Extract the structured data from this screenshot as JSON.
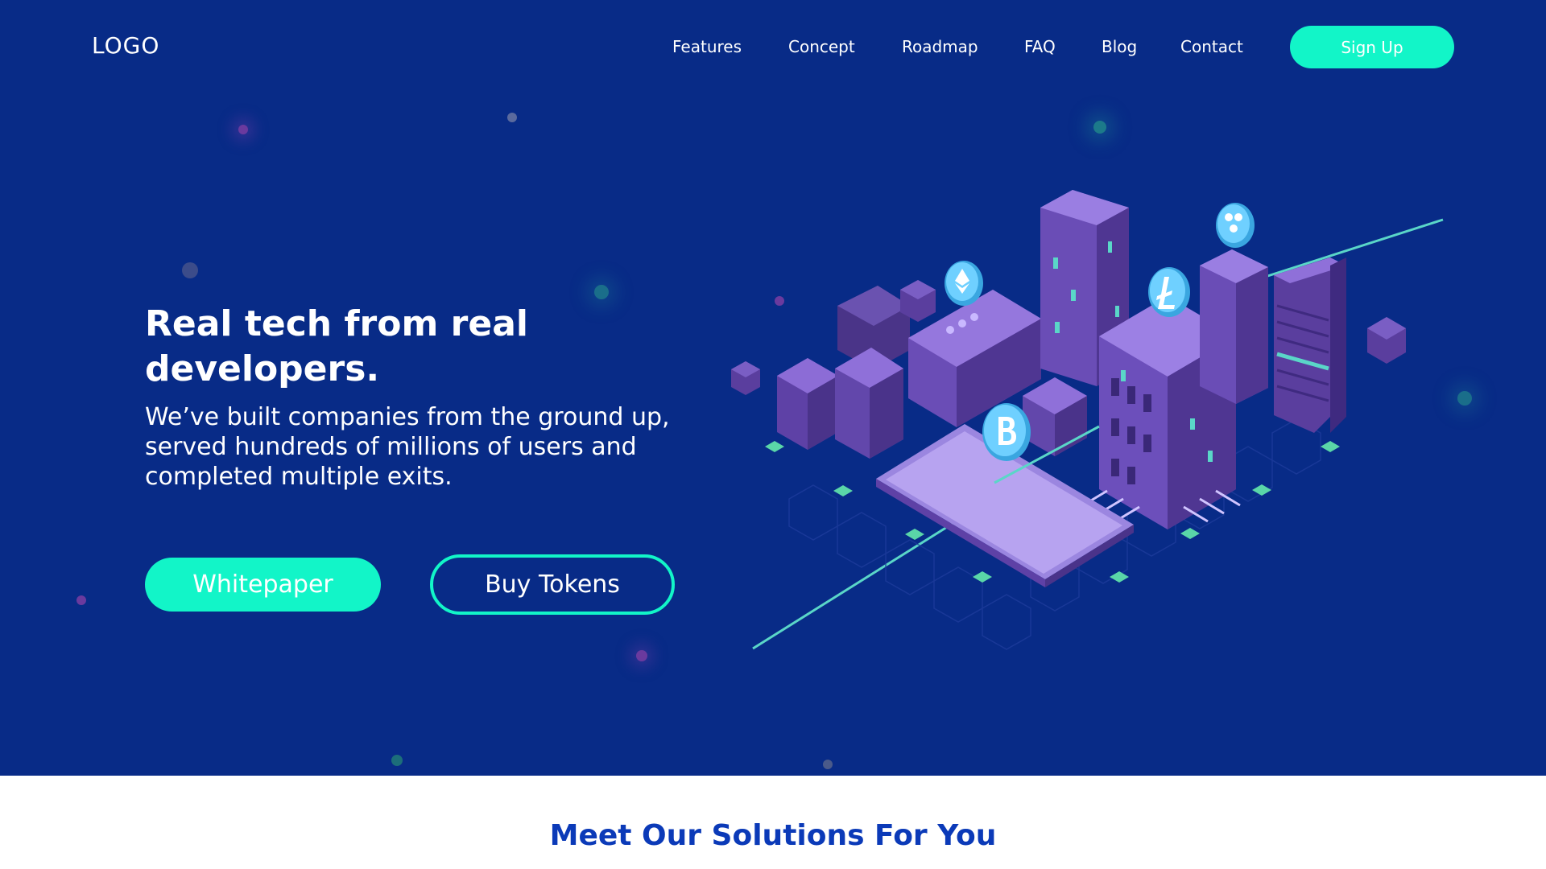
{
  "nav": {
    "logo": "LOGO",
    "links": [
      "Features",
      "Concept",
      "Roadmap",
      "FAQ",
      "Blog",
      "Contact"
    ],
    "signup_label": "Sign Up"
  },
  "hero": {
    "title": "Real tech from real developers.",
    "subtitle": "We’ve built companies from the ground up, served hundreds of millions of users and completed multiple exits.",
    "whitepaper_label": "Whitepaper",
    "buy_tokens_label": "Buy Tokens",
    "illustration": {
      "icons": [
        "ethereum-coin-icon",
        "litecoin-coin-icon",
        "ripple-coin-icon",
        "bitcoin-coin-icon",
        "smartphone-icon"
      ]
    }
  },
  "solutions": {
    "title": "Meet Our Solutions For You"
  },
  "colors": {
    "hero_bg": "#082b87",
    "accent": "#12f5c8",
    "heading_blue": "#0b3ab8",
    "building_purple": "#7a55c4"
  }
}
